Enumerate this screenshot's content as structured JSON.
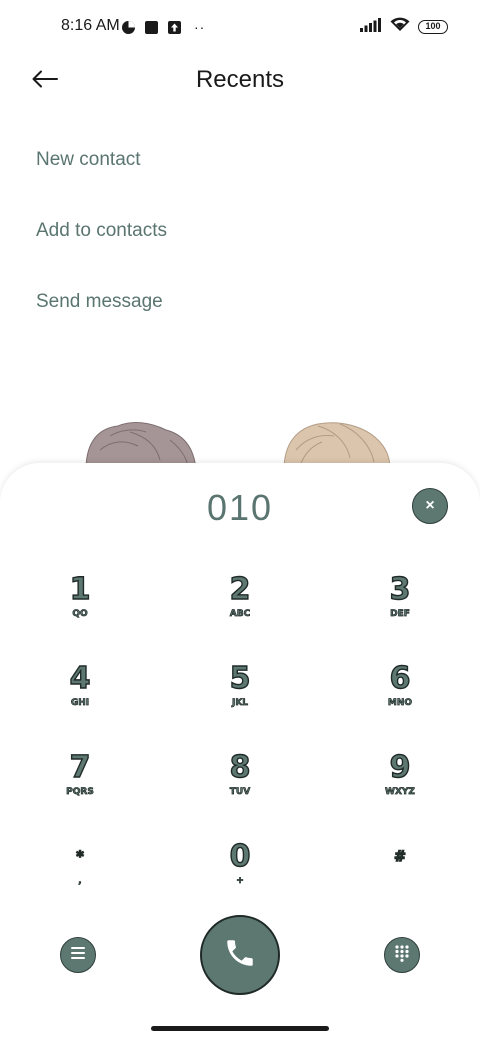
{
  "status_bar": {
    "time": "8:16 AM",
    "dots": "··",
    "battery": "100",
    "icons": [
      "data-saver-icon",
      "square-notification-icon",
      "upload-notification-icon",
      "signal-icon",
      "wifi-icon",
      "battery-icon"
    ]
  },
  "header": {
    "title": "Recents",
    "back_icon": "arrow-left-icon"
  },
  "options": [
    {
      "label": "New contact"
    },
    {
      "label": "Add to contacts"
    },
    {
      "label": "Send message"
    }
  ],
  "dialpad": {
    "number": "010",
    "clear_icon": "close-icon",
    "clear_label": "×",
    "keys": [
      {
        "digit": "1",
        "letters": "QO"
      },
      {
        "digit": "2",
        "letters": "ABC"
      },
      {
        "digit": "3",
        "letters": "DEF"
      },
      {
        "digit": "4",
        "letters": "GHI"
      },
      {
        "digit": "5",
        "letters": "JKL"
      },
      {
        "digit": "6",
        "letters": "MNO"
      },
      {
        "digit": "7",
        "letters": "PQRS"
      },
      {
        "digit": "8",
        "letters": "TUV"
      },
      {
        "digit": "9",
        "letters": "WXYZ"
      },
      {
        "digit": "*",
        "letters": ","
      },
      {
        "digit": "0",
        "letters": "+"
      },
      {
        "digit": "#",
        "letters": ""
      }
    ],
    "menu_icon": "menu-icon",
    "call_icon": "phone-icon",
    "keypad_icon": "dialpad-icon"
  },
  "colors": {
    "accent": "#5d7771",
    "option_text": "#5a7570",
    "outline": "#1f2a27"
  }
}
